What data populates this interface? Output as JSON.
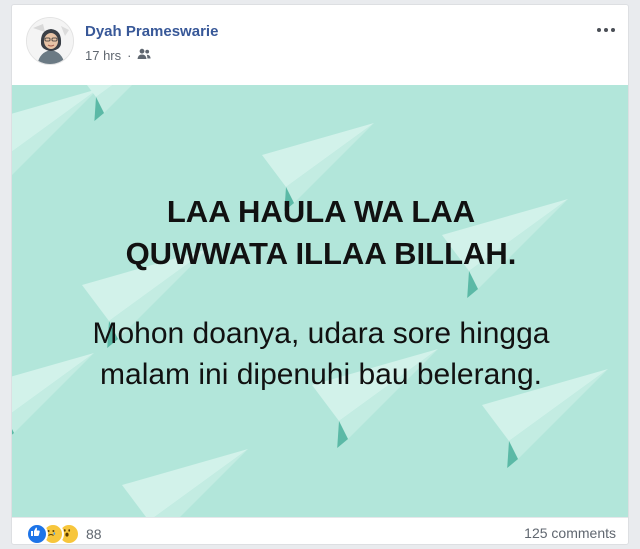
{
  "post": {
    "author": "Dyah Prameswarie",
    "time": "17 hrs",
    "privacy_icon": "friends-icon",
    "menu_icon": "more-options-icon"
  },
  "image": {
    "background_color": "#b2e6da",
    "plane_color": "#d2f2ea",
    "plane_shade_color": "#5bb9a6",
    "headline": "LAA HAULA WA LAA QUWWATA ILLAA BILLAH.",
    "message": "Mohon doanya, udara sore hingga malam ini dipenuhi bau belerang."
  },
  "reactions": {
    "icons": [
      "like-reaction-icon",
      "sad-reaction-icon",
      "wow-reaction-icon"
    ],
    "count": "88"
  },
  "comments": {
    "label": "125 comments"
  },
  "colors": {
    "name_link": "#385898",
    "meta_text": "#606770",
    "like_blue": "#1d74e8",
    "emoji_yellow": "#f7c63c"
  }
}
